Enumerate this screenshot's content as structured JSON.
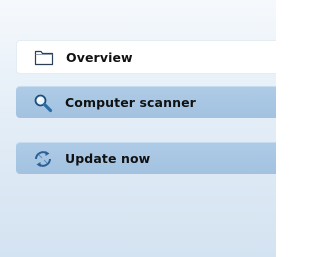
{
  "nav": {
    "items": [
      {
        "label": "Overview",
        "icon": "folder-icon",
        "active": true
      },
      {
        "label": "Computer scanner",
        "icon": "magnifier-icon",
        "active": false
      },
      {
        "label": "Update now",
        "icon": "update-arrows-icon",
        "active": false
      }
    ]
  },
  "colors": {
    "panel_bg_top": "#f6f9fc",
    "panel_bg_bottom": "#d4e3f1",
    "active_item_bg": "#ffffff",
    "inactive_item_bg": "#a9c7e4",
    "text": "#111111"
  }
}
